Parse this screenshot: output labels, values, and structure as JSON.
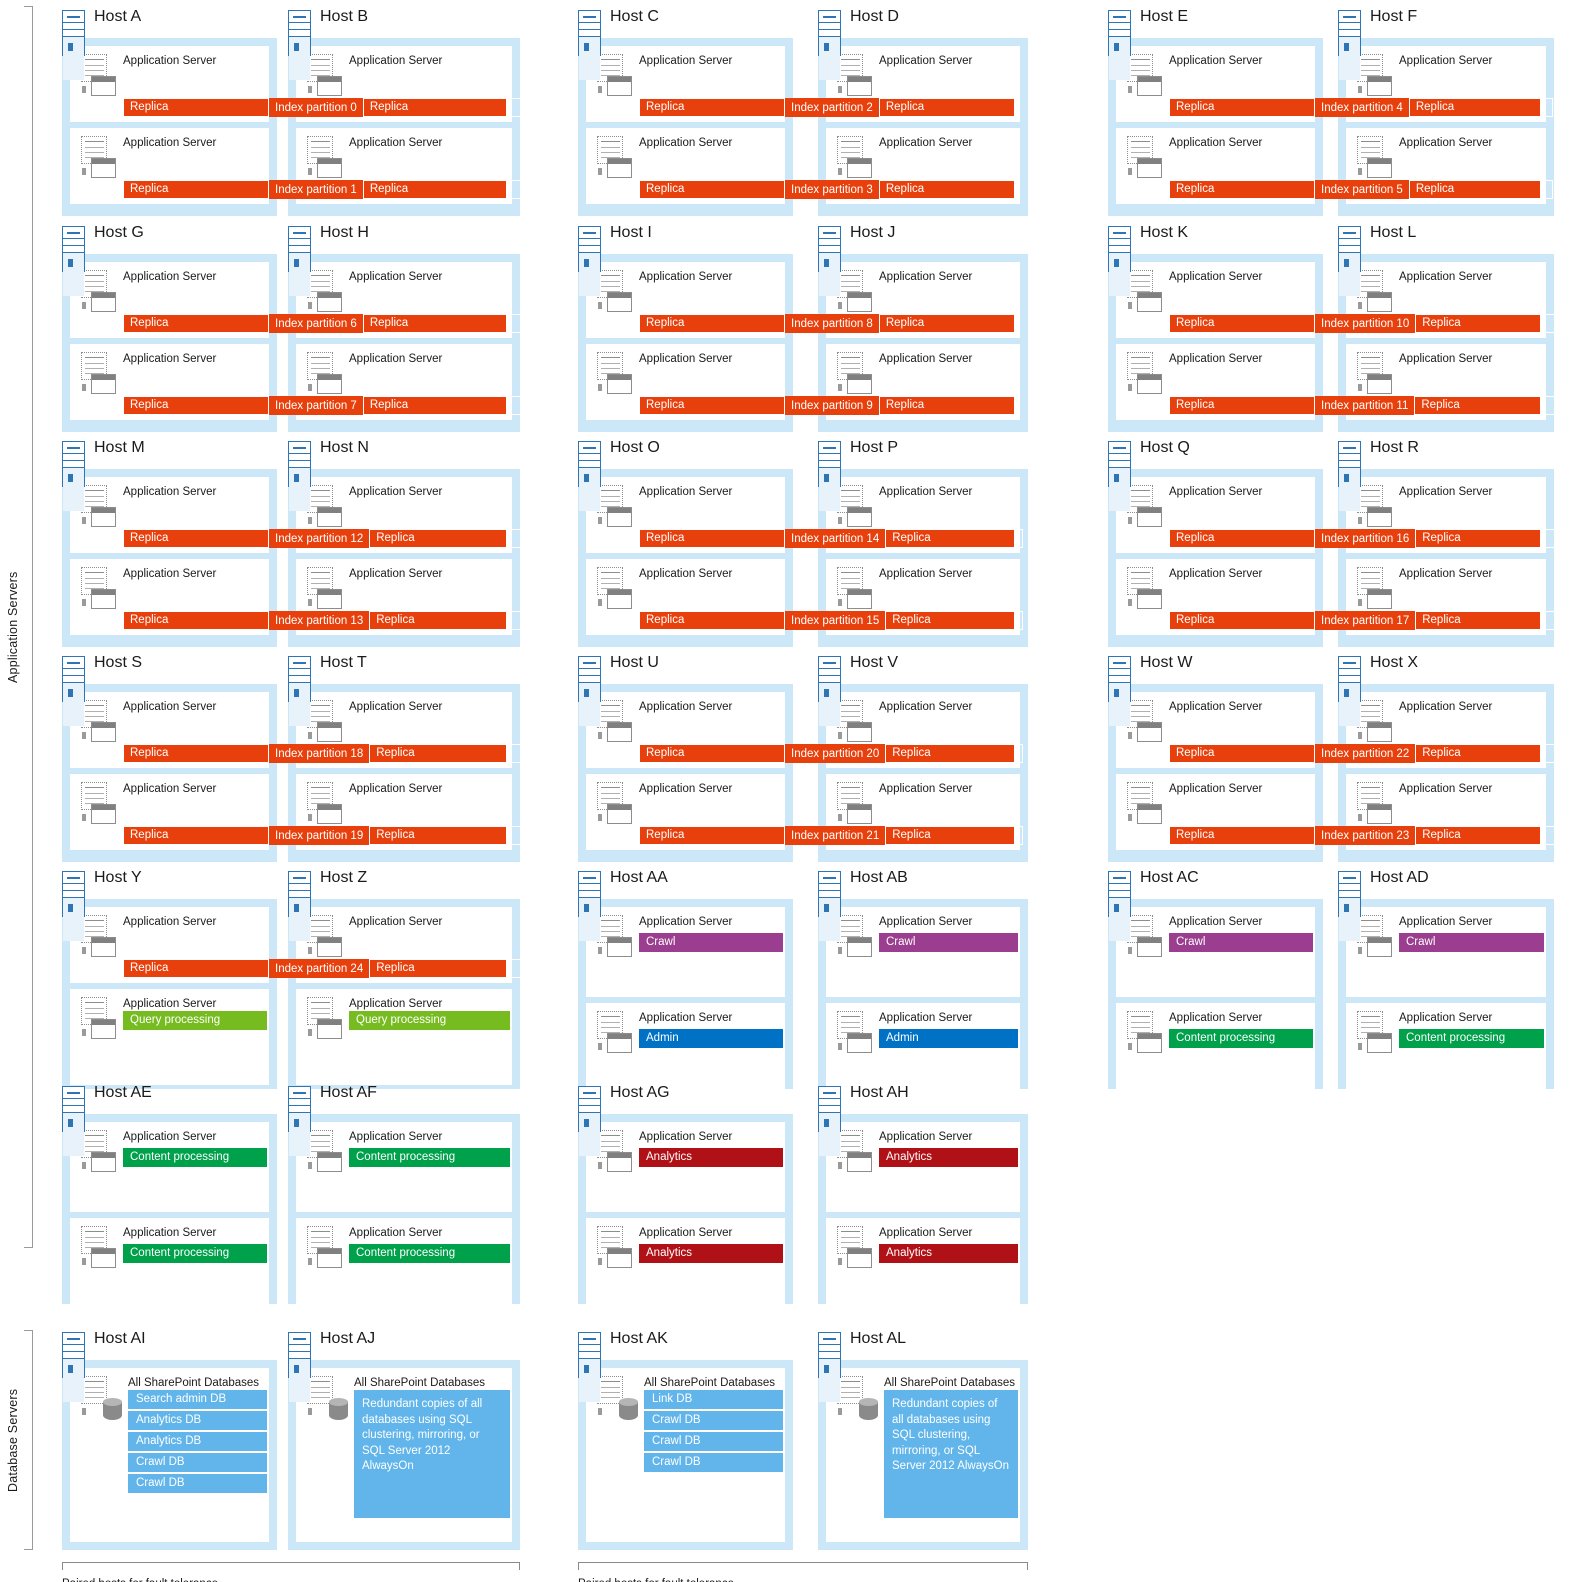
{
  "sections": [
    {
      "id": "application-servers",
      "label": "Application Servers"
    },
    {
      "id": "database-servers",
      "label": "Database Servers"
    }
  ],
  "labels": {
    "application_server": "Application Server",
    "all_sharepoint_databases": "All SharePoint Databases",
    "replica": "Replica",
    "paired_hosts": "Paired hosts for fault tolerance"
  },
  "colors": {
    "index_partition": "#E8400C",
    "crawl": "#9B3E8F",
    "admin": "#0072C6",
    "content_processing": "#00A14B",
    "analytics": "#B01116",
    "query_processing": "#76BC21",
    "database": "#61B5EA",
    "host_panel": "#CCE7F7",
    "host_icon": "#2E75B6"
  },
  "roles": {
    "crawl": "Crawl",
    "admin": "Admin",
    "content_processing": "Content processing",
    "analytics": "Analytics",
    "query_processing": "Query processing"
  },
  "hosts": [
    {
      "name": "Host A"
    },
    {
      "name": "Host B"
    },
    {
      "name": "Host C"
    },
    {
      "name": "Host D"
    },
    {
      "name": "Host E"
    },
    {
      "name": "Host F"
    },
    {
      "name": "Host G"
    },
    {
      "name": "Host H"
    },
    {
      "name": "Host I"
    },
    {
      "name": "Host J"
    },
    {
      "name": "Host K"
    },
    {
      "name": "Host L"
    },
    {
      "name": "Host M"
    },
    {
      "name": "Host N"
    },
    {
      "name": "Host O"
    },
    {
      "name": "Host P"
    },
    {
      "name": "Host Q"
    },
    {
      "name": "Host R"
    },
    {
      "name": "Host S"
    },
    {
      "name": "Host T"
    },
    {
      "name": "Host U"
    },
    {
      "name": "Host V"
    },
    {
      "name": "Host W"
    },
    {
      "name": "Host X"
    },
    {
      "name": "Host Y"
    },
    {
      "name": "Host Z"
    },
    {
      "name": "Host AA"
    },
    {
      "name": "Host AB"
    },
    {
      "name": "Host AC"
    },
    {
      "name": "Host AD"
    },
    {
      "name": "Host AE"
    },
    {
      "name": "Host AF"
    },
    {
      "name": "Host AG"
    },
    {
      "name": "Host AH"
    },
    {
      "name": "Host AI"
    },
    {
      "name": "Host AJ"
    },
    {
      "name": "Host AK"
    },
    {
      "name": "Host AL"
    }
  ],
  "index_partitions": [
    {
      "label": "Index partition 0",
      "hosts": [
        "Host A",
        "Host B"
      ]
    },
    {
      "label": "Index partition 1",
      "hosts": [
        "Host A",
        "Host B"
      ]
    },
    {
      "label": "Index partition 2",
      "hosts": [
        "Host C",
        "Host D"
      ]
    },
    {
      "label": "Index partition 3",
      "hosts": [
        "Host C",
        "Host D"
      ]
    },
    {
      "label": "Index partition 4",
      "hosts": [
        "Host E",
        "Host F"
      ]
    },
    {
      "label": "Index partition 5",
      "hosts": [
        "Host E",
        "Host F"
      ]
    },
    {
      "label": "Index partition 6",
      "hosts": [
        "Host G",
        "Host H"
      ]
    },
    {
      "label": "Index partition 7",
      "hosts": [
        "Host G",
        "Host H"
      ]
    },
    {
      "label": "Index partition 8",
      "hosts": [
        "Host I",
        "Host J"
      ]
    },
    {
      "label": "Index partition 9",
      "hosts": [
        "Host I",
        "Host J"
      ]
    },
    {
      "label": "Index partition 10",
      "hosts": [
        "Host K",
        "Host L"
      ]
    },
    {
      "label": "Index partition 11",
      "hosts": [
        "Host K",
        "Host L"
      ]
    },
    {
      "label": "Index partition 12",
      "hosts": [
        "Host M",
        "Host N"
      ]
    },
    {
      "label": "Index partition 13",
      "hosts": [
        "Host M",
        "Host N"
      ]
    },
    {
      "label": "Index partition 14",
      "hosts": [
        "Host O",
        "Host P"
      ]
    },
    {
      "label": "Index partition 15",
      "hosts": [
        "Host O",
        "Host P"
      ]
    },
    {
      "label": "Index partition 16",
      "hosts": [
        "Host Q",
        "Host R"
      ]
    },
    {
      "label": "Index partition 17",
      "hosts": [
        "Host Q",
        "Host R"
      ]
    },
    {
      "label": "Index partition 18",
      "hosts": [
        "Host S",
        "Host T"
      ]
    },
    {
      "label": "Index partition 19",
      "hosts": [
        "Host S",
        "Host T"
      ]
    },
    {
      "label": "Index partition 20",
      "hosts": [
        "Host U",
        "Host V"
      ]
    },
    {
      "label": "Index partition 21",
      "hosts": [
        "Host U",
        "Host V"
      ]
    },
    {
      "label": "Index partition 22",
      "hosts": [
        "Host W",
        "Host X"
      ]
    },
    {
      "label": "Index partition 23",
      "hosts": [
        "Host W",
        "Host X"
      ]
    },
    {
      "label": "Index partition 24",
      "hosts": [
        "Host Y",
        "Host Z"
      ]
    }
  ],
  "role_hosts": {
    "Host Y": [
      "Query processing"
    ],
    "Host Z": [
      "Query processing"
    ],
    "Host AA": [
      "Crawl",
      "Admin"
    ],
    "Host AB": [
      "Crawl",
      "Admin"
    ],
    "Host AC": [
      "Crawl",
      "Content processing"
    ],
    "Host AD": [
      "Crawl",
      "Content processing"
    ],
    "Host AE": [
      "Content processing",
      "Content processing"
    ],
    "Host AF": [
      "Content processing",
      "Content processing"
    ],
    "Host AG": [
      "Analytics",
      "Analytics"
    ],
    "Host AH": [
      "Analytics",
      "Analytics"
    ]
  },
  "database_hosts": [
    {
      "host": "Host AI",
      "databases": [
        "Search admin DB",
        "Analytics DB",
        "Analytics DB",
        "Crawl DB",
        "Crawl DB"
      ],
      "note": null
    },
    {
      "host": "Host AJ",
      "databases": [],
      "note": "Redundant copies of all databases using SQL clustering, mirroring, or SQL Server 2012 AlwaysOn"
    },
    {
      "host": "Host AK",
      "databases": [
        "Link DB",
        "Crawl DB",
        "Crawl DB",
        "Crawl DB"
      ],
      "note": null
    },
    {
      "host": "Host AL",
      "databases": [],
      "note": "Redundant copies of all databases using SQL clustering, mirroring, or SQL Server 2012 AlwaysOn"
    }
  ],
  "pair_brackets": [
    {
      "caption": "Paired hosts for fault tolerance",
      "hosts": [
        "Host AI",
        "Host AJ"
      ]
    },
    {
      "caption": "Paired hosts for fault tolerance",
      "hosts": [
        "Host AK",
        "Host AL"
      ]
    }
  ]
}
